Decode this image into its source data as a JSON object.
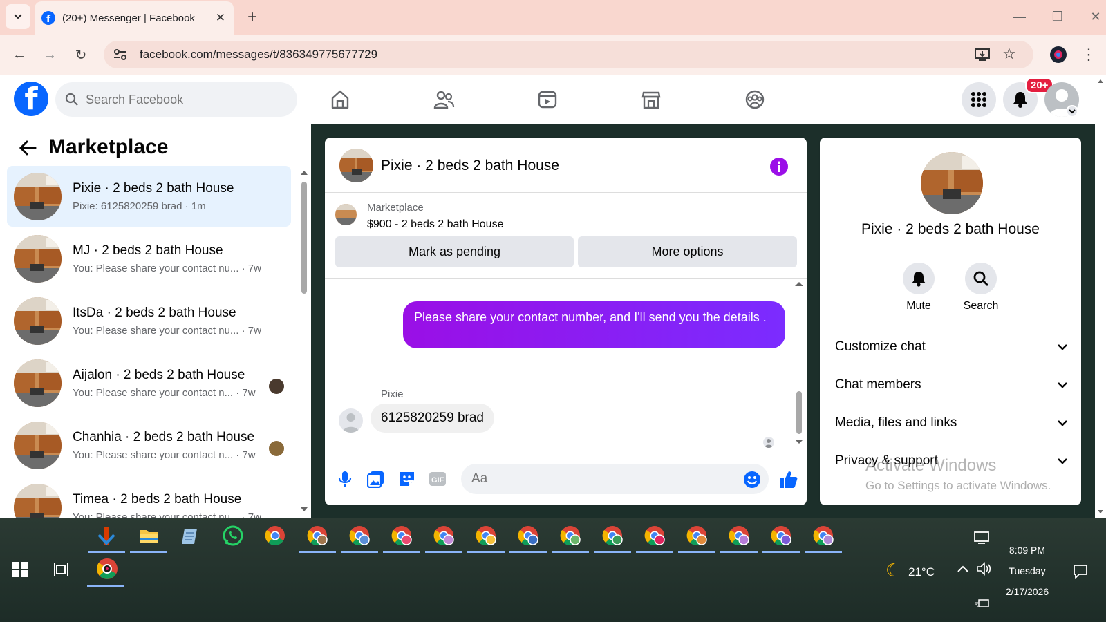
{
  "browser": {
    "tab_title": "(20+) Messenger | Facebook",
    "url": "facebook.com/messages/t/836349775677729"
  },
  "fb": {
    "search_placeholder": "Search Facebook",
    "notif_badge": "20+"
  },
  "left": {
    "title": "Marketplace",
    "conversations": [
      {
        "name": "Pixie · 2 beds 2 bath House",
        "snippet": "Pixie: 6125820259 brad · 1m"
      },
      {
        "name": "MJ · 2 beds 2 bath House",
        "snippet": "You: Please share your contact nu...",
        "time": "· 7w"
      },
      {
        "name": "ItsDa · 2 beds 2 bath House",
        "snippet": "You: Please share your contact nu...",
        "time": "· 7w"
      },
      {
        "name": "Aijalon · 2 beds 2 bath House",
        "snippet": "You: Please share your contact n...",
        "time": "· 7w"
      },
      {
        "name": "Chanhia · 2 beds 2 bath House",
        "snippet": "You: Please share your contact n...",
        "time": "· 7w"
      },
      {
        "name": "Timea · 2 beds 2 bath House",
        "snippet": "You: Please share your contact nu...",
        "time": "· 7w"
      }
    ]
  },
  "chat": {
    "name": "Pixie · 2 beds 2 bath House",
    "marketplace_label": "Marketplace",
    "listing": "$900 - 2 beds 2 bath House",
    "mark_pending": "Mark as pending",
    "more_options": "More options",
    "outgoing": "Please share your contact number, and I'll send you the details .",
    "sender": "Pixie",
    "incoming": "6125820259 brad",
    "composer_placeholder": "Aa"
  },
  "info": {
    "name": "Pixie · 2 beds 2 bath House",
    "mute": "Mute",
    "search": "Search",
    "sections": [
      "Customize chat",
      "Chat members",
      "Media, files and links",
      "Privacy & support"
    ],
    "watermark_title": "Activate Windows",
    "watermark_sub": "Go to Settings to activate Windows."
  },
  "taskbar": {
    "weather": "21°C",
    "time": "8:09 PM",
    "day": "Tuesday",
    "date": "2/17/2026"
  },
  "colors": {
    "fb_blue": "#0866ff",
    "messenger_purple": "#8a1cf0",
    "badge_red": "#e41e3f"
  }
}
